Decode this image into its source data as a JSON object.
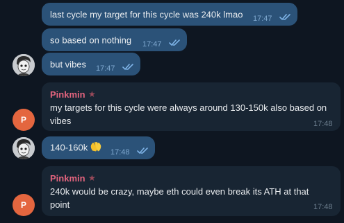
{
  "messages": [
    {
      "text": "last cycle my target for this cycle was 240k lmao",
      "time": "17:47"
    },
    {
      "text": "so based on nothing",
      "time": "17:47"
    },
    {
      "text": "but vibes",
      "time": "17:47"
    },
    {
      "sender": "Pinkmin",
      "line1": "my targets for this cycle were always around 130-150k also based on",
      "line2": "vibes",
      "time": "17:48"
    },
    {
      "text": "140-160k",
      "emoji": "clapping-hands",
      "time": "17:48"
    },
    {
      "sender": "Pinkmin",
      "line1": "240k would be crazy, maybe eth could even break its ATH at that",
      "line2": "point",
      "time": "17:48"
    }
  ],
  "avatars": {
    "pinkmin_letter": "P"
  },
  "colors": {
    "background": "#0e1621",
    "outgoing_bubble": "#2b5278",
    "incoming_bubble": "#182533",
    "sender_name": "#e3647e",
    "avatar_p": "#e4663f",
    "read_checks": "#7fb4e8"
  }
}
